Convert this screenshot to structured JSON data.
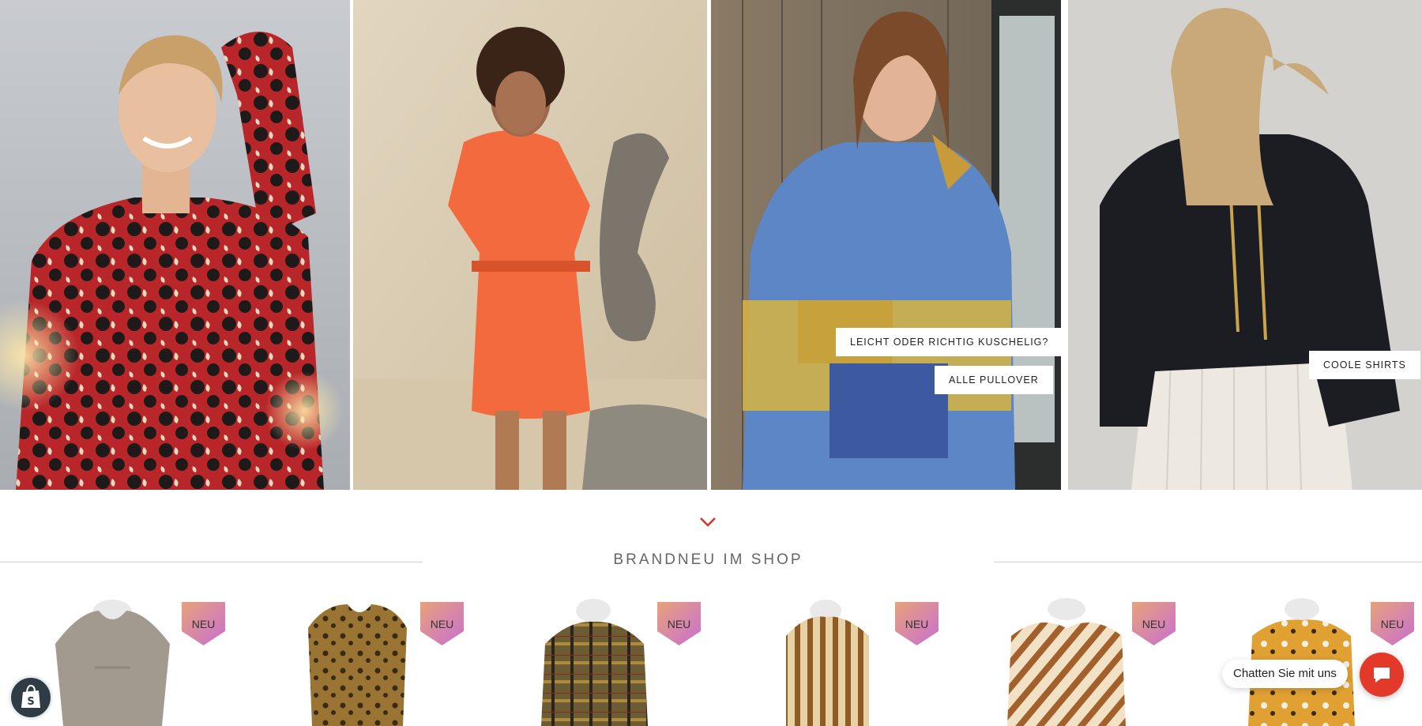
{
  "hero": {
    "tiles": [
      {
        "name": "floral-blouse-tile",
        "buttons": []
      },
      {
        "name": "orange-dress-tile",
        "buttons": []
      },
      {
        "name": "pullover-tile",
        "buttons": [
          "LEICHT ODER RICHTIG KUSCHELIG?",
          "ALLE PULLOVER"
        ]
      },
      {
        "name": "shirts-tile",
        "buttons": [
          "COOLE SHIRTS"
        ]
      }
    ]
  },
  "section": {
    "title": "BRANDNEU IM SHOP",
    "chevron_icon": "chevron-down-icon"
  },
  "products": [
    {
      "badge": "NEU",
      "color": "#9f968c"
    },
    {
      "badge": "NEU",
      "color": "#8a6a2c"
    },
    {
      "badge": "NEU",
      "color": "#6b5a32"
    },
    {
      "badge": "NEU",
      "color": "#9b7036"
    },
    {
      "badge": "NEU",
      "color": "#b07a35"
    },
    {
      "badge": "NEU",
      "color": "#d99a2e"
    }
  ],
  "chat": {
    "label": "Chatten Sie mit uns",
    "icon": "chat-bubble-icon"
  },
  "shopify": {
    "icon": "shopify-bag-icon"
  },
  "colors": {
    "accent": "#c8362a",
    "chat_button": "#e2392a",
    "badge_gradient_from": "#e7a27a",
    "badge_gradient_to": "#c96fd0"
  }
}
